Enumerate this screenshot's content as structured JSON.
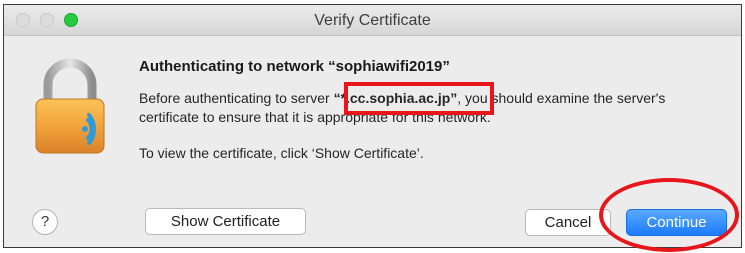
{
  "window": {
    "title": "Verify Certificate"
  },
  "dialog": {
    "heading": "Authenticating to network “sophiawifi2019”",
    "body_before": "Before authenticating to server ",
    "server": "“*.cc.sophia.ac.jp”",
    "body_after": ", you should examine the server's certificate to ensure that it is appropriate for this network.",
    "hint": "To view the certificate, click ‘Show Certificate’.",
    "icon": "wifi-lock-icon"
  },
  "buttons": {
    "help": "?",
    "show_certificate": "Show Certificate",
    "cancel": "Cancel",
    "continue": "Continue"
  },
  "annotations": {
    "color": "#e8151b"
  },
  "colors": {
    "accent": "#1b7cff",
    "lock_gold": "#f2a33a",
    "wifi_blue": "#2f9ad8"
  }
}
